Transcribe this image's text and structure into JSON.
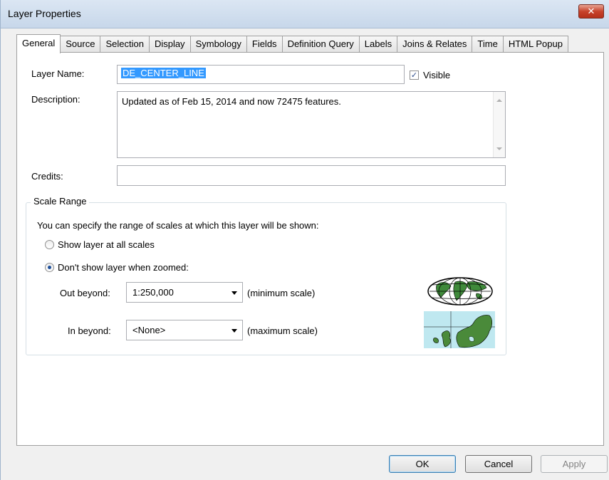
{
  "window": {
    "title": "Layer Properties",
    "close_glyph": "✕"
  },
  "tabs": [
    {
      "label": "General",
      "active": true
    },
    {
      "label": "Source"
    },
    {
      "label": "Selection"
    },
    {
      "label": "Display"
    },
    {
      "label": "Symbology"
    },
    {
      "label": "Fields"
    },
    {
      "label": "Definition Query"
    },
    {
      "label": "Labels"
    },
    {
      "label": "Joins & Relates"
    },
    {
      "label": "Time"
    },
    {
      "label": "HTML Popup"
    }
  ],
  "general": {
    "layer_name_label": "Layer Name:",
    "layer_name_value": "DE_CENTER_LINE",
    "visible_label": "Visible",
    "visible_checked": true,
    "description_label": "Description:",
    "description_value": "Updated as of Feb 15, 2014 and now 72475 features.",
    "credits_label": "Credits:",
    "credits_value": ""
  },
  "scale_range": {
    "legend": "Scale Range",
    "intro": "You can specify the range of scales at which this layer will be shown:",
    "option_all": "Show layer at all scales",
    "option_zoom": "Don't show layer when zoomed:",
    "selected": "zoom",
    "out_beyond_label": "Out beyond:",
    "out_beyond_value": "1:250,000",
    "out_beyond_hint": "(minimum scale)",
    "in_beyond_label": "In beyond:",
    "in_beyond_value": "<None>",
    "in_beyond_hint": "(maximum scale)"
  },
  "buttons": {
    "ok": "OK",
    "cancel": "Cancel",
    "apply": "Apply"
  },
  "colors": {
    "selection": "#3399ff",
    "land": "#4a8a3a",
    "water": "#bfe8f0"
  }
}
